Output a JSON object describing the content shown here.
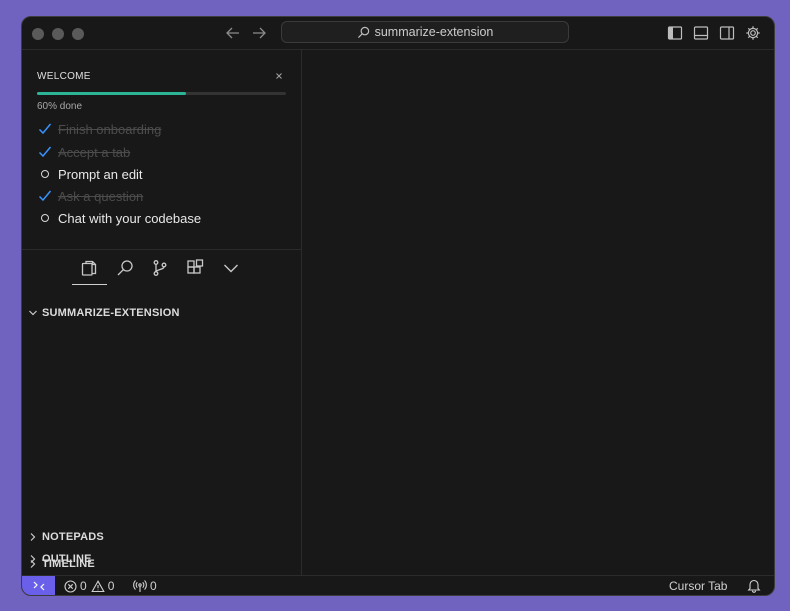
{
  "titlebar": {
    "search_text": "summarize-extension"
  },
  "welcome": {
    "title": "WELCOME",
    "progress_percent": 60,
    "progress_text": "60% done",
    "tasks": [
      {
        "label": "Finish onboarding",
        "done": true
      },
      {
        "label": "Accept a tab",
        "done": true
      },
      {
        "label": "Prompt an edit",
        "done": false
      },
      {
        "label": "Ask a question",
        "done": true
      },
      {
        "label": "Chat with your codebase",
        "done": false
      }
    ]
  },
  "explorer": {
    "folder_name": "SUMMARIZE-EXTENSION",
    "sections": [
      "NOTEPADS",
      "OUTLINE",
      "TIMELINE"
    ]
  },
  "statusbar": {
    "errors": "0",
    "warnings": "0",
    "ports": "0",
    "cursor_tab": "Cursor Tab"
  },
  "colors": {
    "accent": "#6a5fe8",
    "progress": "#2bb596",
    "check": "#3794ff"
  }
}
